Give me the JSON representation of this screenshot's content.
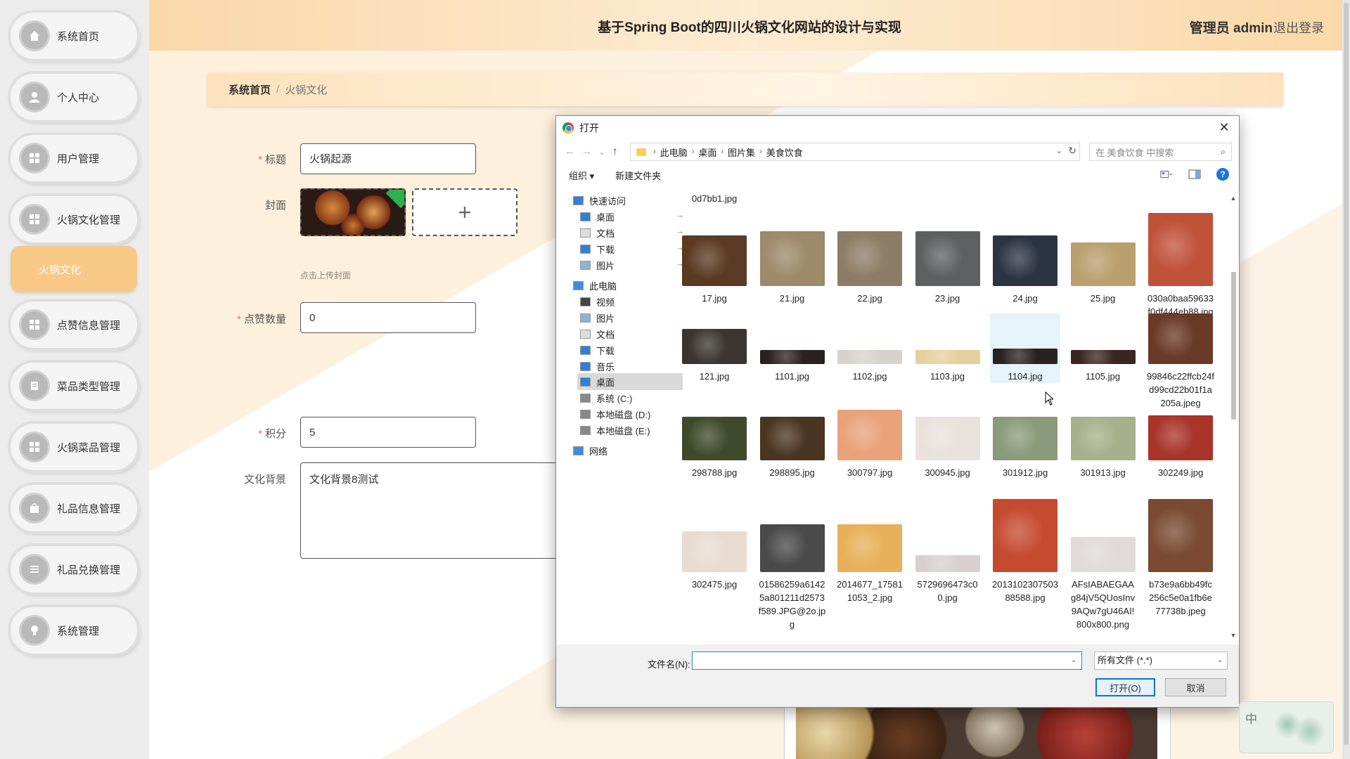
{
  "header": {
    "title": "基于Spring Boot的四川火锅文化网站的设计与实现",
    "admin": "管理员 admin",
    "logout": "退出登录"
  },
  "sidebar": {
    "items": [
      {
        "label": "系统首页",
        "icon": "home-icon"
      },
      {
        "label": "个人中心",
        "icon": "user-icon"
      },
      {
        "label": "用户管理",
        "icon": "grid-icon"
      },
      {
        "label": "火锅文化管理",
        "icon": "grid-icon"
      },
      {
        "label": "火锅文化",
        "icon": "none",
        "active": true
      },
      {
        "label": "点赞信息管理",
        "icon": "grid-icon"
      },
      {
        "label": "菜品类型管理",
        "icon": "doc-icon"
      },
      {
        "label": "火锅菜品管理",
        "icon": "grid-icon"
      },
      {
        "label": "礼品信息管理",
        "icon": "bag-icon"
      },
      {
        "label": "礼品兑换管理",
        "icon": "list-icon"
      },
      {
        "label": "系统管理",
        "icon": "settings-icon"
      }
    ]
  },
  "breadcrumb": {
    "home": "系统首页",
    "separator": "/",
    "current": "火锅文化"
  },
  "form": {
    "title_label": "标题",
    "title_value": "火锅起源",
    "cover_label": "封面",
    "cover_add": "+",
    "cover_hint": "点击上传封面",
    "likes_label": "点赞数量",
    "likes_value": "0",
    "points_label": "积分",
    "points_value": "5",
    "background_label": "文化背景",
    "background_value": "文化背景8测试",
    "required_mark": "*"
  },
  "dialog": {
    "title": "打开",
    "close": "✕",
    "path": [
      "此电脑",
      "桌面",
      "图片集",
      "美食饮食"
    ],
    "search_placeholder": "在 美食饮食 中搜索",
    "organize": "组织 ▾",
    "new_folder": "新建文件夹",
    "nav": [
      {
        "label": "快速访问",
        "icon": "star-icon",
        "indent": 0
      },
      {
        "label": "桌面",
        "icon": "desktop-icon",
        "indent": 1,
        "pinned": true
      },
      {
        "label": "文档",
        "icon": "document-icon",
        "indent": 1,
        "pinned": true
      },
      {
        "label": "下载",
        "icon": "download-icon",
        "indent": 1,
        "pinned": true
      },
      {
        "label": "图片",
        "icon": "picture-icon",
        "indent": 1,
        "pinned": true
      },
      {
        "label": "此电脑",
        "icon": "pc-icon",
        "indent": 0
      },
      {
        "label": "视频",
        "icon": "video-icon",
        "indent": 1
      },
      {
        "label": "图片",
        "icon": "picture-icon",
        "indent": 1
      },
      {
        "label": "文档",
        "icon": "document-icon",
        "indent": 1
      },
      {
        "label": "下载",
        "icon": "download-icon",
        "indent": 1
      },
      {
        "label": "音乐",
        "icon": "music-icon",
        "indent": 1
      },
      {
        "label": "桌面",
        "icon": "desktop-icon",
        "indent": 1,
        "selected": true
      },
      {
        "label": "系统 (C:)",
        "icon": "drive-icon",
        "indent": 1
      },
      {
        "label": "本地磁盘 (D:)",
        "icon": "drive-icon",
        "indent": 1
      },
      {
        "label": "本地磁盘 (E:)",
        "icon": "drive-icon",
        "indent": 1
      },
      {
        "label": "网络",
        "icon": "network-icon",
        "indent": 0
      }
    ],
    "partial_top_file": "0d7bb1.jpg",
    "files": [
      {
        "name": "17.jpg",
        "color": "#5a3a22"
      },
      {
        "name": "21.jpg",
        "color": "#9c8a6a"
      },
      {
        "name": "22.jpg",
        "color": "#8d7d66"
      },
      {
        "name": "23.jpg",
        "color": "#5e5f60"
      },
      {
        "name": "24.jpg",
        "color": "#2c3444"
      },
      {
        "name": "25.jpg",
        "color": "#b9a06e"
      },
      {
        "name": "030a0baa59633f0df444eb88.jpg",
        "color": "#c0523a"
      },
      {
        "name": "121.jpg",
        "color": "#3a3530"
      },
      {
        "name": "1101.jpg",
        "color": "#2a2220"
      },
      {
        "name": "1102.jpg",
        "color": "#d8d2cc"
      },
      {
        "name": "1103.jpg",
        "color": "#e6cf9e"
      },
      {
        "name": "1104.jpg",
        "color": "#2a2220",
        "hover": true
      },
      {
        "name": "1105.jpg",
        "color": "#3a2520"
      },
      {
        "name": "99846c22ffcb24fd99cd22b01f1a205a.jpeg",
        "color": "#6a3a28"
      },
      {
        "name": "298788.jpg",
        "color": "#3f4a2a"
      },
      {
        "name": "298895.jpg",
        "color": "#4a3522"
      },
      {
        "name": "300797.jpg",
        "color": "#e9a27a"
      },
      {
        "name": "300945.jpg",
        "color": "#e8e2dc"
      },
      {
        "name": "301912.jpg",
        "color": "#8a9a7a"
      },
      {
        "name": "301913.jpg",
        "color": "#a7b08a"
      },
      {
        "name": "302249.jpg",
        "color": "#a8342a"
      },
      {
        "name": "302475.jpg",
        "color": "#e8dcd2"
      },
      {
        "name": "01586259a61425a801211d2573f589.JPG@2o.jpg",
        "color": "#4a4a4a"
      },
      {
        "name": "2014677_175811053_2.jpg",
        "color": "#e8b05a"
      },
      {
        "name": "5729696473c00.jpg",
        "color": "#d8d0d0"
      },
      {
        "name": "201310230750388588.jpg",
        "color": "#c44a30"
      },
      {
        "name": "AFsIABAEGAAg84jV5QUosInv9AQw7gU46AI!800x800.png",
        "color": "#e0dada"
      },
      {
        "name": "b73e9a6bb49fc256c5e0a1fb6e77738b.jpeg",
        "color": "#7a4a32"
      }
    ],
    "filename_label": "文件名(N):",
    "filename_value": "",
    "filetype": "所有文件 (*.*)",
    "open_button": "打开(O)",
    "cancel_button": "取消"
  },
  "ime": {
    "lang": "中"
  }
}
